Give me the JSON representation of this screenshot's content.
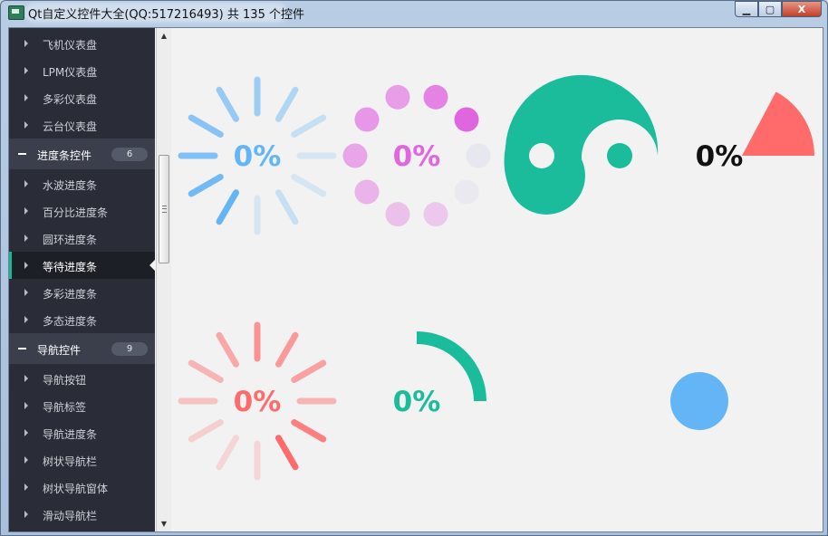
{
  "window": {
    "title": "Qt自定义控件大全(QQ:517216493) 共 135 个控件",
    "buttons": {
      "minimize": "▁",
      "maximize": "▢",
      "close": "X"
    }
  },
  "sidebar": {
    "items_before": [
      {
        "label": "飞机仪表盘"
      },
      {
        "label": "LPM仪表盘"
      },
      {
        "label": "多彩仪表盘"
      },
      {
        "label": "云台仪表盘"
      }
    ],
    "group1": {
      "label": "进度条控件",
      "count": "6"
    },
    "progress_items": [
      {
        "label": "水波进度条"
      },
      {
        "label": "百分比进度条"
      },
      {
        "label": "圆环进度条"
      },
      {
        "label": "等待进度条",
        "selected": true
      },
      {
        "label": "多彩进度条"
      },
      {
        "label": "多态进度条"
      }
    ],
    "group2": {
      "label": "导航控件",
      "count": "9"
    },
    "nav_items": [
      {
        "label": "导航按钮"
      },
      {
        "label": "导航标签"
      },
      {
        "label": "导航进度条"
      },
      {
        "label": "树状导航栏"
      },
      {
        "label": "树状导航窗体"
      },
      {
        "label": "滑动导航栏"
      }
    ]
  },
  "progress_widgets": [
    {
      "style": "spokes",
      "value_text": "0%",
      "color": "#64b5f6"
    },
    {
      "style": "dots",
      "value_text": "0%",
      "color": "#e066e0"
    },
    {
      "style": "taichi",
      "value_text": "",
      "color": "#1abc9c"
    },
    {
      "style": "pie",
      "value_text": "0%",
      "color": "#ff6b6b"
    },
    {
      "style": "spokes",
      "value_text": "0%",
      "color": "#ff6b6b"
    },
    {
      "style": "arc",
      "value_text": "0%",
      "color": "#1abc9c"
    },
    {
      "style": "circle",
      "value_text": "",
      "color": "#64b5f6"
    }
  ]
}
